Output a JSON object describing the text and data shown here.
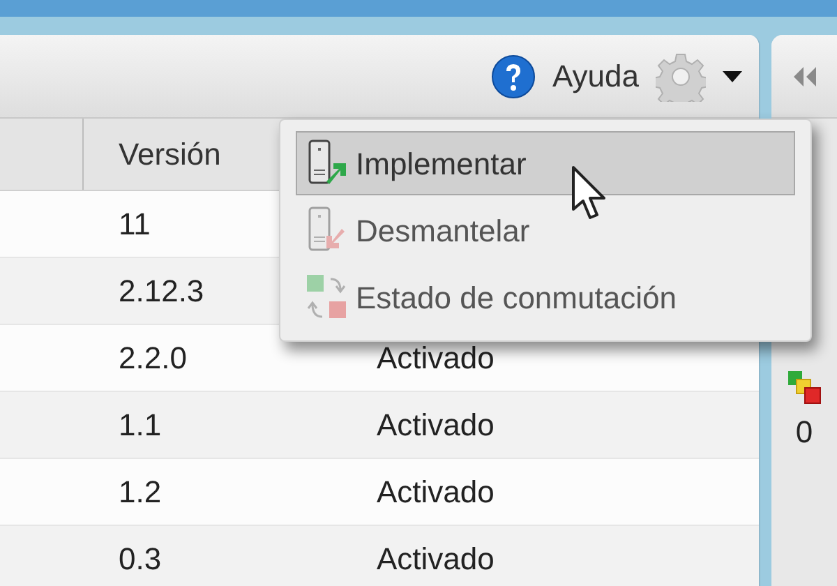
{
  "toolbar": {
    "help_label": "Ayuda"
  },
  "table": {
    "columns": [
      {
        "label": "Versión"
      }
    ],
    "rows": [
      {
        "version": "11"
      },
      {
        "version": "2.12.3"
      },
      {
        "version": "2.2.0",
        "status": "Activado"
      },
      {
        "version": "1.1",
        "status": "Activado"
      },
      {
        "version": "1.2",
        "status": "Activado"
      },
      {
        "version": "0.3",
        "status": "Activado"
      }
    ]
  },
  "menu": {
    "items": [
      {
        "kind": "deploy",
        "label": "Implementar",
        "selected": true,
        "disabled": false
      },
      {
        "kind": "undeploy",
        "label": "Desmantelar",
        "selected": false,
        "disabled": true
      },
      {
        "kind": "switch",
        "label": "Estado de conmutación",
        "selected": false,
        "disabled": true
      }
    ]
  },
  "side_panel": {
    "count": "0"
  }
}
